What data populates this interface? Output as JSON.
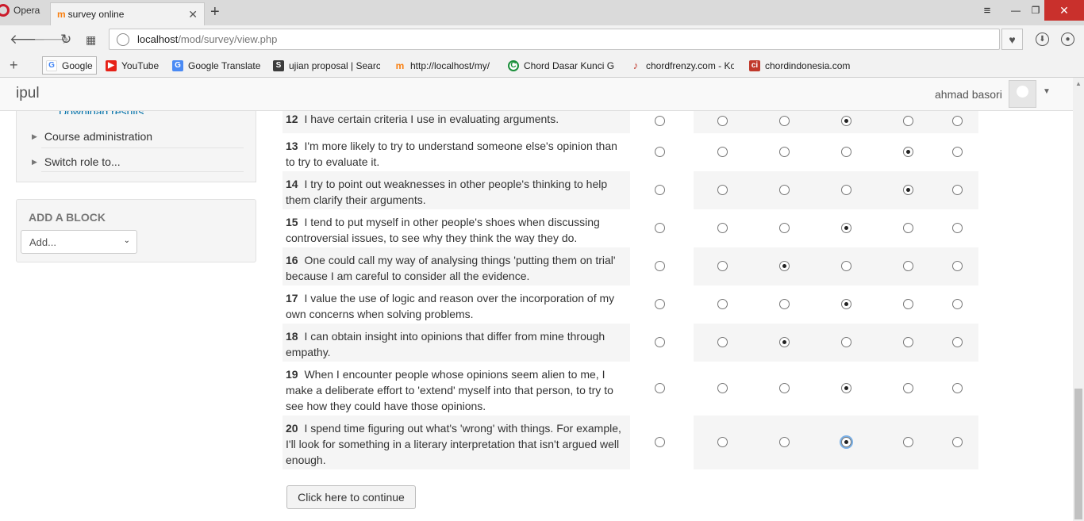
{
  "browser": {
    "menu_label": "Opera",
    "tab_title": "survey online",
    "url_host": "localhost",
    "url_path": "/mod/survey/view.php",
    "bookmarks": [
      {
        "label": "Google",
        "icon": "google-icon",
        "color": "#4285f4"
      },
      {
        "label": "YouTube",
        "icon": "youtube-icon",
        "color": "#e62117"
      },
      {
        "label": "Google Translate",
        "icon": "translate-icon",
        "color": "#4a8af4"
      },
      {
        "label": "ujian proposal | Searc",
        "icon": "proposal-icon",
        "color": "#3b3b3b"
      },
      {
        "label": "http://localhost/my/",
        "icon": "moodle-icon",
        "color": "#f98012"
      },
      {
        "label": "Chord Dasar Kunci G",
        "icon": "chord-icon",
        "color": "#1a8f3a"
      },
      {
        "label": "chordfrenzy.com - Ko",
        "icon": "guitar-icon",
        "color": "#c0392b"
      },
      {
        "label": "chordindonesia.com",
        "icon": "ci-icon",
        "color": "#c0392b"
      }
    ]
  },
  "site": {
    "brand": "ipul",
    "user_name": "ahmad basori"
  },
  "sidebar": {
    "download_link": "Download results",
    "nav_items": [
      "Course administration",
      "Switch role to..."
    ],
    "add_block_title": "ADD A BLOCK",
    "add_block_select": "Add..."
  },
  "survey": {
    "selected_color": "#222222",
    "questions": [
      {
        "num": "12",
        "text": "I have certain criteria I use in evaluating arguments.",
        "selected": 4
      },
      {
        "num": "13",
        "text": "I'm more likely to try to understand someone else's opinion than to try to evaluate it.",
        "selected": 5
      },
      {
        "num": "14",
        "text": "I try to point out weaknesses in other people's thinking to help them clarify their arguments.",
        "selected": 5
      },
      {
        "num": "15",
        "text": "I tend to put myself in other people's shoes when discussing controversial issues, to see why they think the way they do.",
        "selected": 4
      },
      {
        "num": "16",
        "text": "One could call my way of analysing things 'putting them on trial' because I am careful to consider all the evidence.",
        "selected": 3
      },
      {
        "num": "17",
        "text": "I value the use of logic and reason over the incorporation of my own concerns when solving problems.",
        "selected": 4
      },
      {
        "num": "18",
        "text": "I can obtain insight into opinions that differ from mine through empathy.",
        "selected": 3
      },
      {
        "num": "19",
        "text": "When I encounter people whose opinions seem alien to me, I make a deliberate effort to 'extend' myself into that person, to try to see how they could have those opinions.",
        "selected": 4
      },
      {
        "num": "20",
        "text": "I spend time figuring out what's 'wrong' with things. For example, I'll look for something in a literary interpretation that isn't argued well enough.",
        "selected": 4
      }
    ],
    "continue_label": "Click here to continue"
  }
}
